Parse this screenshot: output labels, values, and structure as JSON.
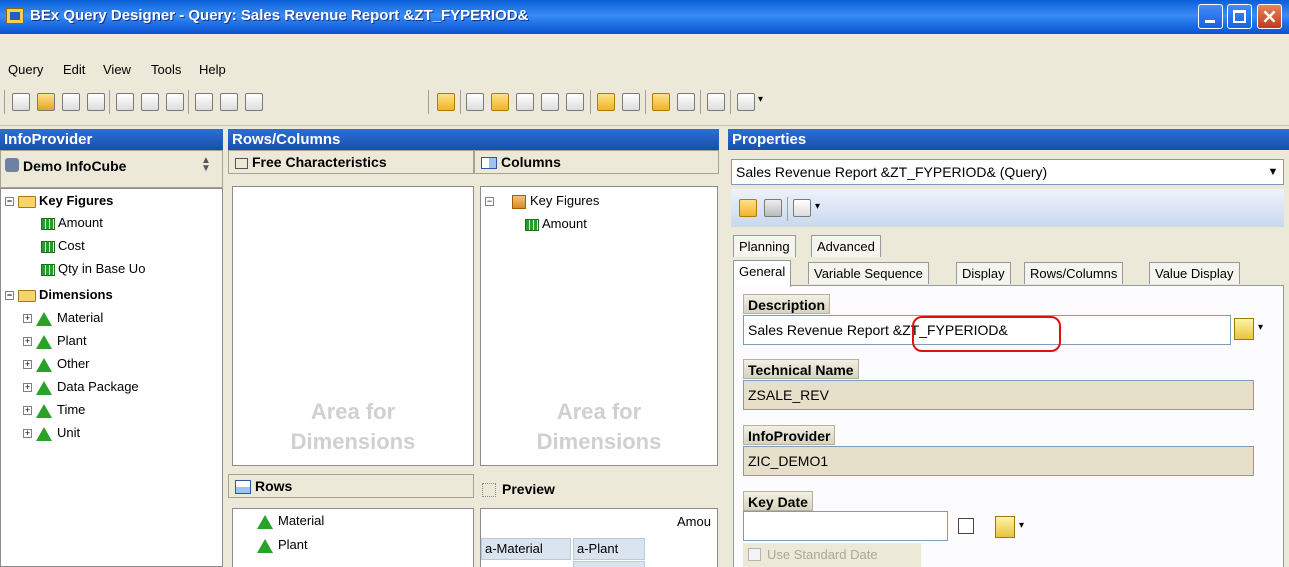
{
  "window": {
    "title": "BEx Query Designer - Query: Sales Revenue Report &ZT_FYPERIOD&"
  },
  "menu": [
    "Query",
    "Edit",
    "View",
    "Tools",
    "Help"
  ],
  "infoprovider_panel": {
    "header": "InfoProvider",
    "cube": "Demo InfoCube",
    "key_figures_label": "Key Figures",
    "key_figures": [
      "Amount",
      "Cost",
      "Qty in Base Uo"
    ],
    "dimensions_label": "Dimensions",
    "dimensions": [
      "Material",
      "Plant",
      "Other",
      "Data Package",
      "Time",
      "Unit"
    ]
  },
  "rows_columns_panel": {
    "header": "Rows/Columns",
    "free_characteristics": "Free Characteristics",
    "columns": "Columns",
    "columns_tree": {
      "root": "Key Figures",
      "child": "Amount"
    },
    "watermark_line1": "Area for",
    "watermark_line2": "Dimensions",
    "rows": "Rows",
    "rows_items": [
      "Material",
      "Plant"
    ],
    "preview": "Preview",
    "preview_col": "Amou",
    "preview_cells": [
      "a-Material",
      "a-Plant"
    ]
  },
  "properties_panel": {
    "header": "Properties",
    "selector_value": "Sales Revenue Report &ZT_FYPERIOD& (Query)",
    "tabs_row1": [
      "Planning",
      "Advanced"
    ],
    "tabs_row2": [
      "General",
      "Variable Sequence",
      "Display",
      "Rows/Columns",
      "Value Display"
    ],
    "description_label": "Description",
    "description_value": "Sales Revenue Report &ZT_FYPERIOD&",
    "technical_name_label": "Technical Name",
    "technical_name_value": "ZSALE_REV",
    "infoprovider_label": "InfoProvider",
    "infoprovider_value": "ZIC_DEMO1",
    "key_date_label": "Key Date",
    "key_date_value": "",
    "use_standard_date": "Use Standard Date"
  },
  "colors": {
    "titlebar": "#1f6fe6",
    "panel_header": "#184fae",
    "highlight_circle": "#e01010"
  }
}
